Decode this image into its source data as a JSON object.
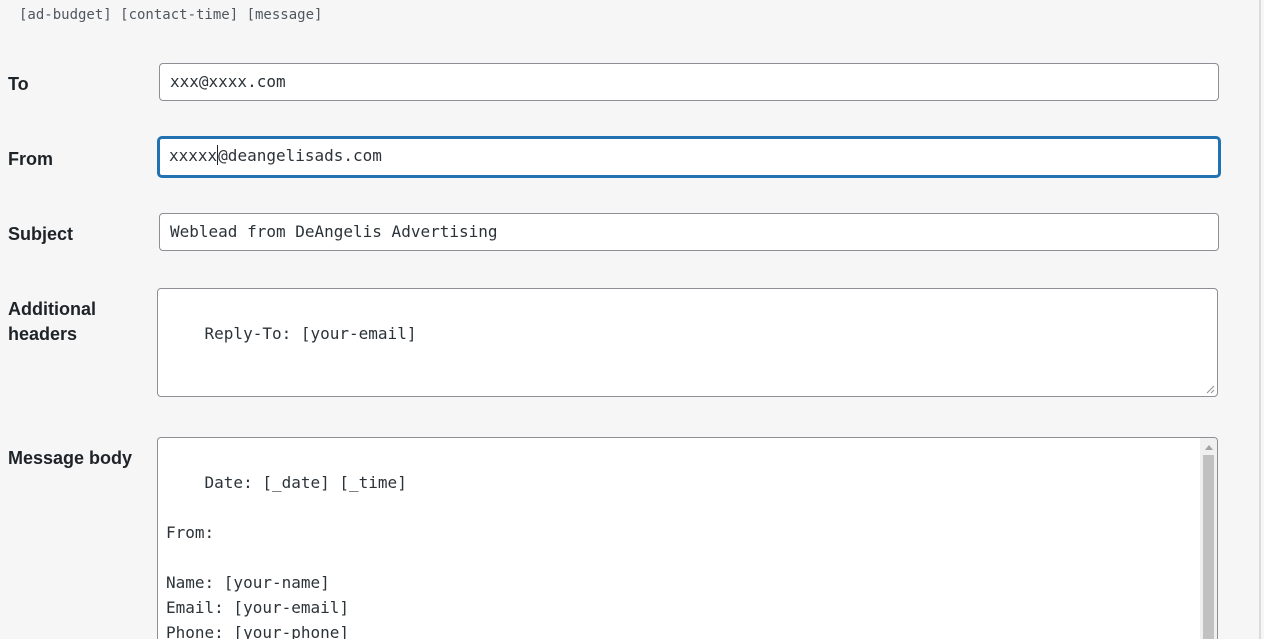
{
  "mail_tags": "[ad-budget] [contact-time] [message]",
  "fields": {
    "to": {
      "label": "To",
      "value": "xxx@xxxx.com"
    },
    "from": {
      "label": "From",
      "value_before_caret": "xxxxx",
      "value_after_caret": "@deangelisads.com"
    },
    "subject": {
      "label": "Subject",
      "value": "Weblead from DeAngelis Advertising"
    },
    "additional_headers": {
      "label": "Additional headers",
      "value": "Reply-To: [your-email]"
    },
    "message_body": {
      "label": "Message body",
      "value": "Date: [_date] [_time]\n\nFrom:\n\nName: [your-name]\nEmail: [your-email]\nPhone: [your-phone]"
    }
  },
  "colors": {
    "focus": "#2271b1",
    "border": "#8c8f94",
    "background": "#f6f6f6"
  },
  "icons": {
    "resize": "resize-grip-icon",
    "scroll_up": "scroll-up-arrow-icon"
  }
}
